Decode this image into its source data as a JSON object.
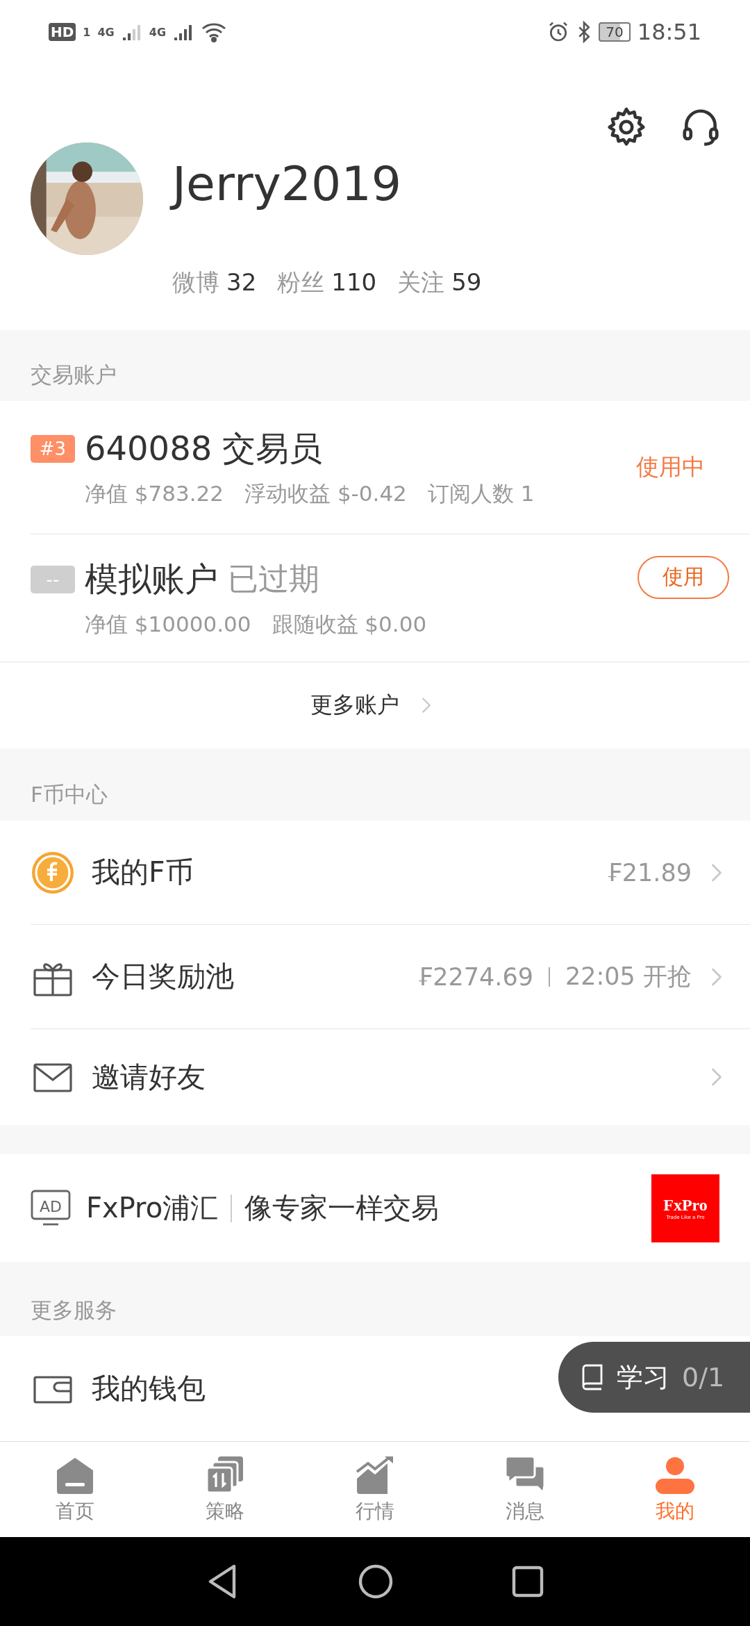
{
  "status_bar": {
    "hd": "HD",
    "sim": "1",
    "networks": [
      "4G",
      "4G"
    ],
    "battery": "70",
    "time": "18:51"
  },
  "profile": {
    "username": "Jerry2019",
    "stats": [
      {
        "label": "微博",
        "value": "32"
      },
      {
        "label": "粉丝",
        "value": "110"
      },
      {
        "label": "关注",
        "value": "59"
      }
    ]
  },
  "trading_accounts": {
    "title": "交易账户",
    "accounts": [
      {
        "kind": "current",
        "badge": "#3",
        "name": "640088 交易员",
        "status": "使用中",
        "details": [
          "净值 $783.22",
          "浮动收益 $-0.42",
          "订阅人数 1"
        ]
      },
      {
        "kind": "expired",
        "badge": "--",
        "name": "模拟账户",
        "tag": "已过期",
        "status": "使用",
        "details": [
          "净值 $10000.00",
          "跟随收益 $0.00"
        ]
      }
    ],
    "more": "更多账户"
  },
  "fcoin_center": {
    "title": "F币中心",
    "items": [
      {
        "kind": "coin",
        "label": "我的F币",
        "value": "₣21.89"
      },
      {
        "kind": "gift",
        "label": "今日奖励池",
        "value": "₣2274.69",
        "extra": "22:05 开抢"
      },
      {
        "kind": "mail",
        "label": "邀请好友"
      }
    ]
  },
  "ad": {
    "icon_label": "AD",
    "brand": "FxPro浦汇",
    "slogan": "像专家一样交易",
    "logo_text": "FxPro",
    "logo_tagline": "Trade Like a Pro"
  },
  "more_services": {
    "title": "更多服务",
    "items": [
      {
        "kind": "wallet",
        "label": "我的钱包"
      }
    ]
  },
  "study_button": {
    "label": "学习",
    "progress": "0/1"
  },
  "tabs": [
    {
      "kind": "home",
      "label": "首页",
      "selected": false
    },
    {
      "kind": "strategy",
      "label": "策略",
      "selected": false
    },
    {
      "kind": "market",
      "label": "行情",
      "selected": false
    },
    {
      "kind": "messages",
      "label": "消息",
      "selected": false
    },
    {
      "kind": "me",
      "label": "我的",
      "selected": true
    }
  ]
}
